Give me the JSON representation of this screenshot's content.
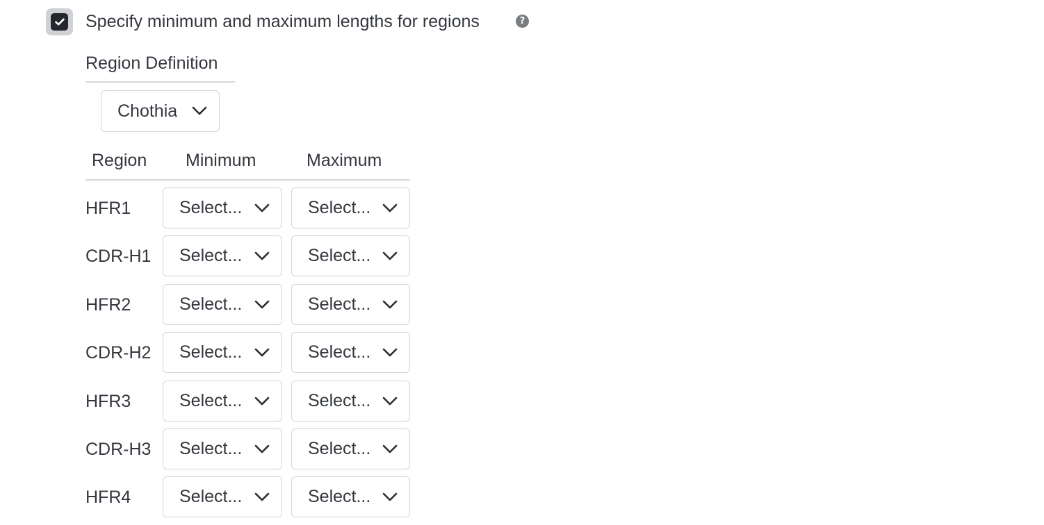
{
  "checkbox": {
    "checked": true,
    "label": "Specify minimum and maximum lengths for regions",
    "help_icon": "question-circle-icon"
  },
  "region_definition": {
    "heading": "Region Definition",
    "selected": "Chothia"
  },
  "table": {
    "headers": {
      "region": "Region",
      "minimum": "Minimum",
      "maximum": "Maximum"
    },
    "rows": [
      {
        "region": "HFR1",
        "minimum": "Select...",
        "maximum": "Select..."
      },
      {
        "region": "CDR-H1",
        "minimum": "Select...",
        "maximum": "Select..."
      },
      {
        "region": "HFR2",
        "minimum": "Select...",
        "maximum": "Select..."
      },
      {
        "region": "CDR-H2",
        "minimum": "Select...",
        "maximum": "Select..."
      },
      {
        "region": "HFR3",
        "minimum": "Select...",
        "maximum": "Select..."
      },
      {
        "region": "CDR-H3",
        "minimum": "Select...",
        "maximum": "Select..."
      },
      {
        "region": "HFR4",
        "minimum": "Select...",
        "maximum": "Select..."
      }
    ]
  },
  "colors": {
    "text": "#33373d",
    "checkbox_fill": "#24272c",
    "checkbox_ring": "#cfd1d4",
    "border": "#d2d4d7"
  }
}
